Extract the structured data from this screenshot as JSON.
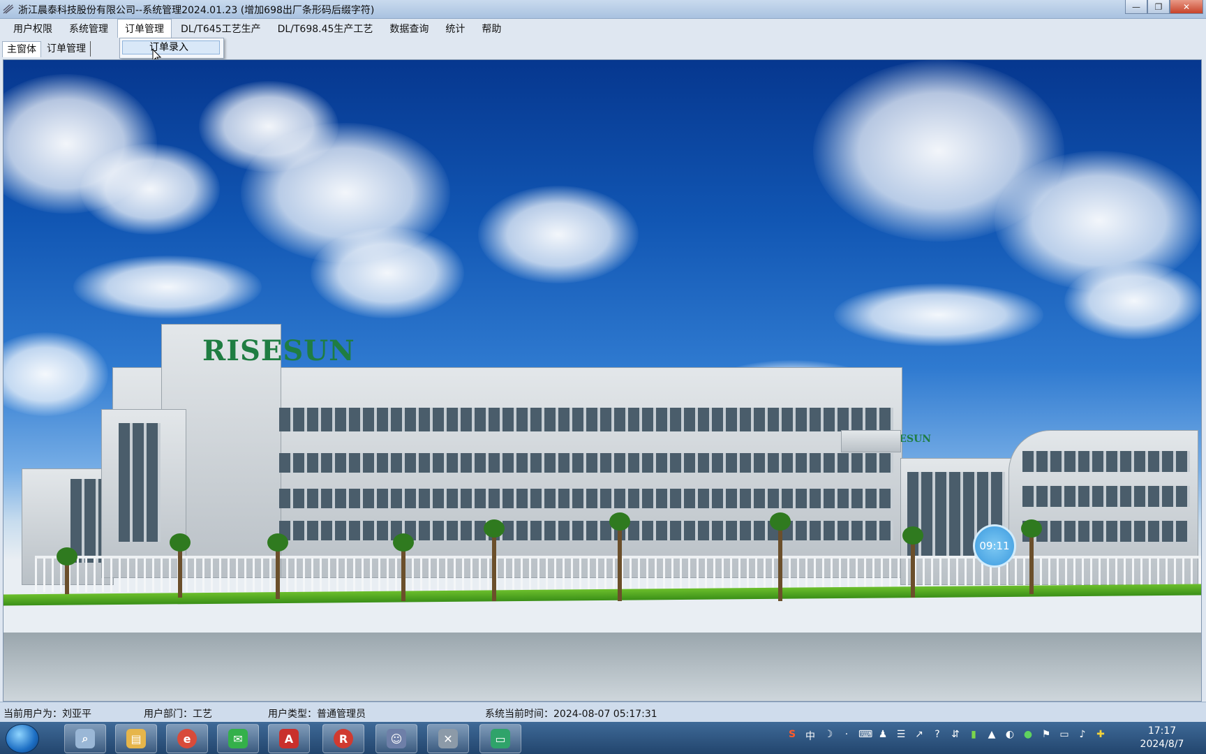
{
  "window": {
    "title": "浙江晨泰科技股份有限公司--系统管理2024.01.23 (增加698出厂条形码后缀字符)",
    "controls": {
      "minimize": "—",
      "maximize": "❐",
      "close": "✕"
    }
  },
  "menubar": {
    "items": [
      "用户权限",
      "系统管理",
      "订单管理",
      "DL/T645工艺生产",
      "DL/T698.45生产工艺",
      "数据查询",
      "统计",
      "帮助"
    ],
    "active": "订单管理"
  },
  "dropdown": {
    "items": [
      "订单录入"
    ]
  },
  "tabs": [
    "主窗体",
    "订单管理"
  ],
  "canvas": {
    "brand_sign": "RISESUN",
    "clock_badge": "09:11"
  },
  "statusbar": {
    "user": "当前用户为：刘亚平",
    "department": "用户部门：工艺",
    "user_type": "用户类型：普通管理员",
    "system_time": "系统当前时间：2024-08-07 05:17:31"
  },
  "taskbar": {
    "apps": [
      "search",
      "file-explorer",
      "chrome",
      "wechat",
      "pdf-reader",
      "risesun",
      "user-tool",
      "tools",
      "wechat-work"
    ],
    "tray_icons": [
      "S",
      "中",
      "☽",
      "·",
      "⌨",
      "♟",
      "☰",
      "↗",
      "?",
      "⇵",
      "▮",
      "▲",
      "◐",
      "●",
      "⚑",
      "▭",
      "♪",
      "✚"
    ],
    "time": "17:17",
    "date": "2024/8/7"
  },
  "colors": {
    "title_bar": "#b7cde8",
    "menu_bg": "#dfe7f1",
    "status_bg": "#cfdcec",
    "taskbar": "#2e5684"
  }
}
